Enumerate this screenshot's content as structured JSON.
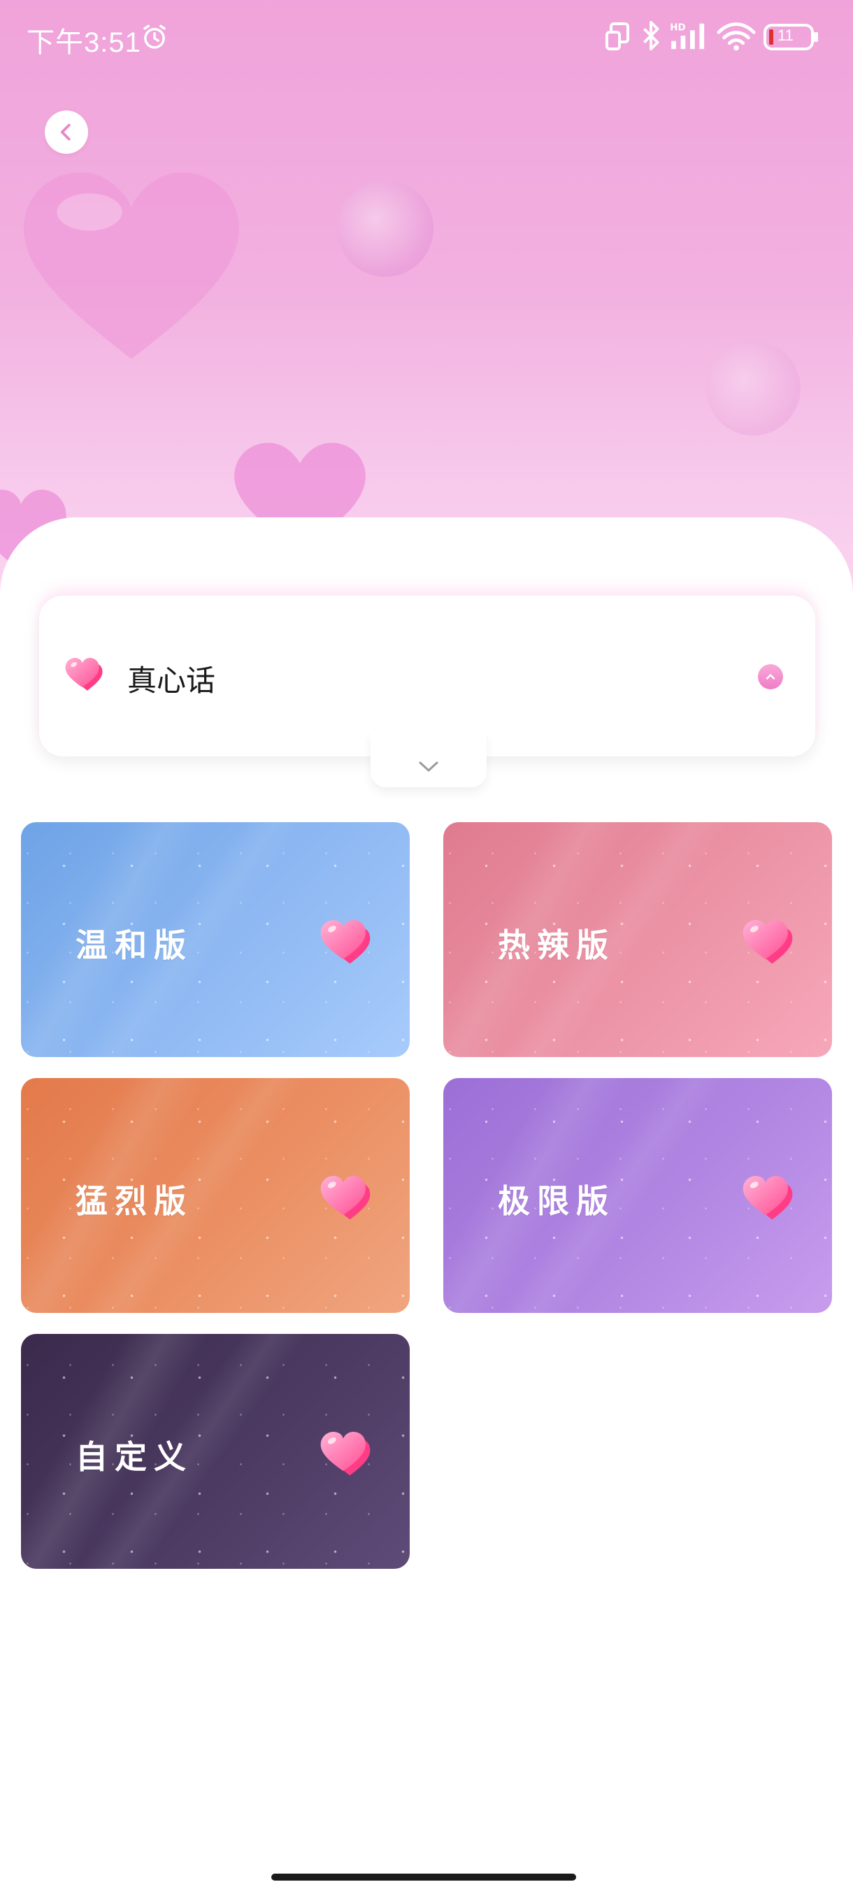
{
  "status_bar": {
    "time": "下午3:51",
    "battery_level": "11",
    "icons": [
      "alarm-icon",
      "screen-rotate-icon",
      "bluetooth-icon",
      "hd-signal-icon",
      "wifi-icon",
      "battery-icon"
    ]
  },
  "header": {
    "back_icon": "chevron-left-icon"
  },
  "topic": {
    "label": "真心话",
    "icon": "heart-icon",
    "toggle_icon": "chevron-up-icon",
    "expand_icon": "chevron-down-icon"
  },
  "modes": [
    {
      "label": "温和版",
      "color": "#8fb9f3"
    },
    {
      "label": "热辣版",
      "color": "#ec93a6"
    },
    {
      "label": "猛烈版",
      "color": "#eb8f63"
    },
    {
      "label": "极限版",
      "color": "#b085e2"
    },
    {
      "label": "自定义",
      "color": "#4c3a62"
    }
  ],
  "colors": {
    "hero_pink": "#f0a3da",
    "heart_pink": "#ff5fa0"
  }
}
